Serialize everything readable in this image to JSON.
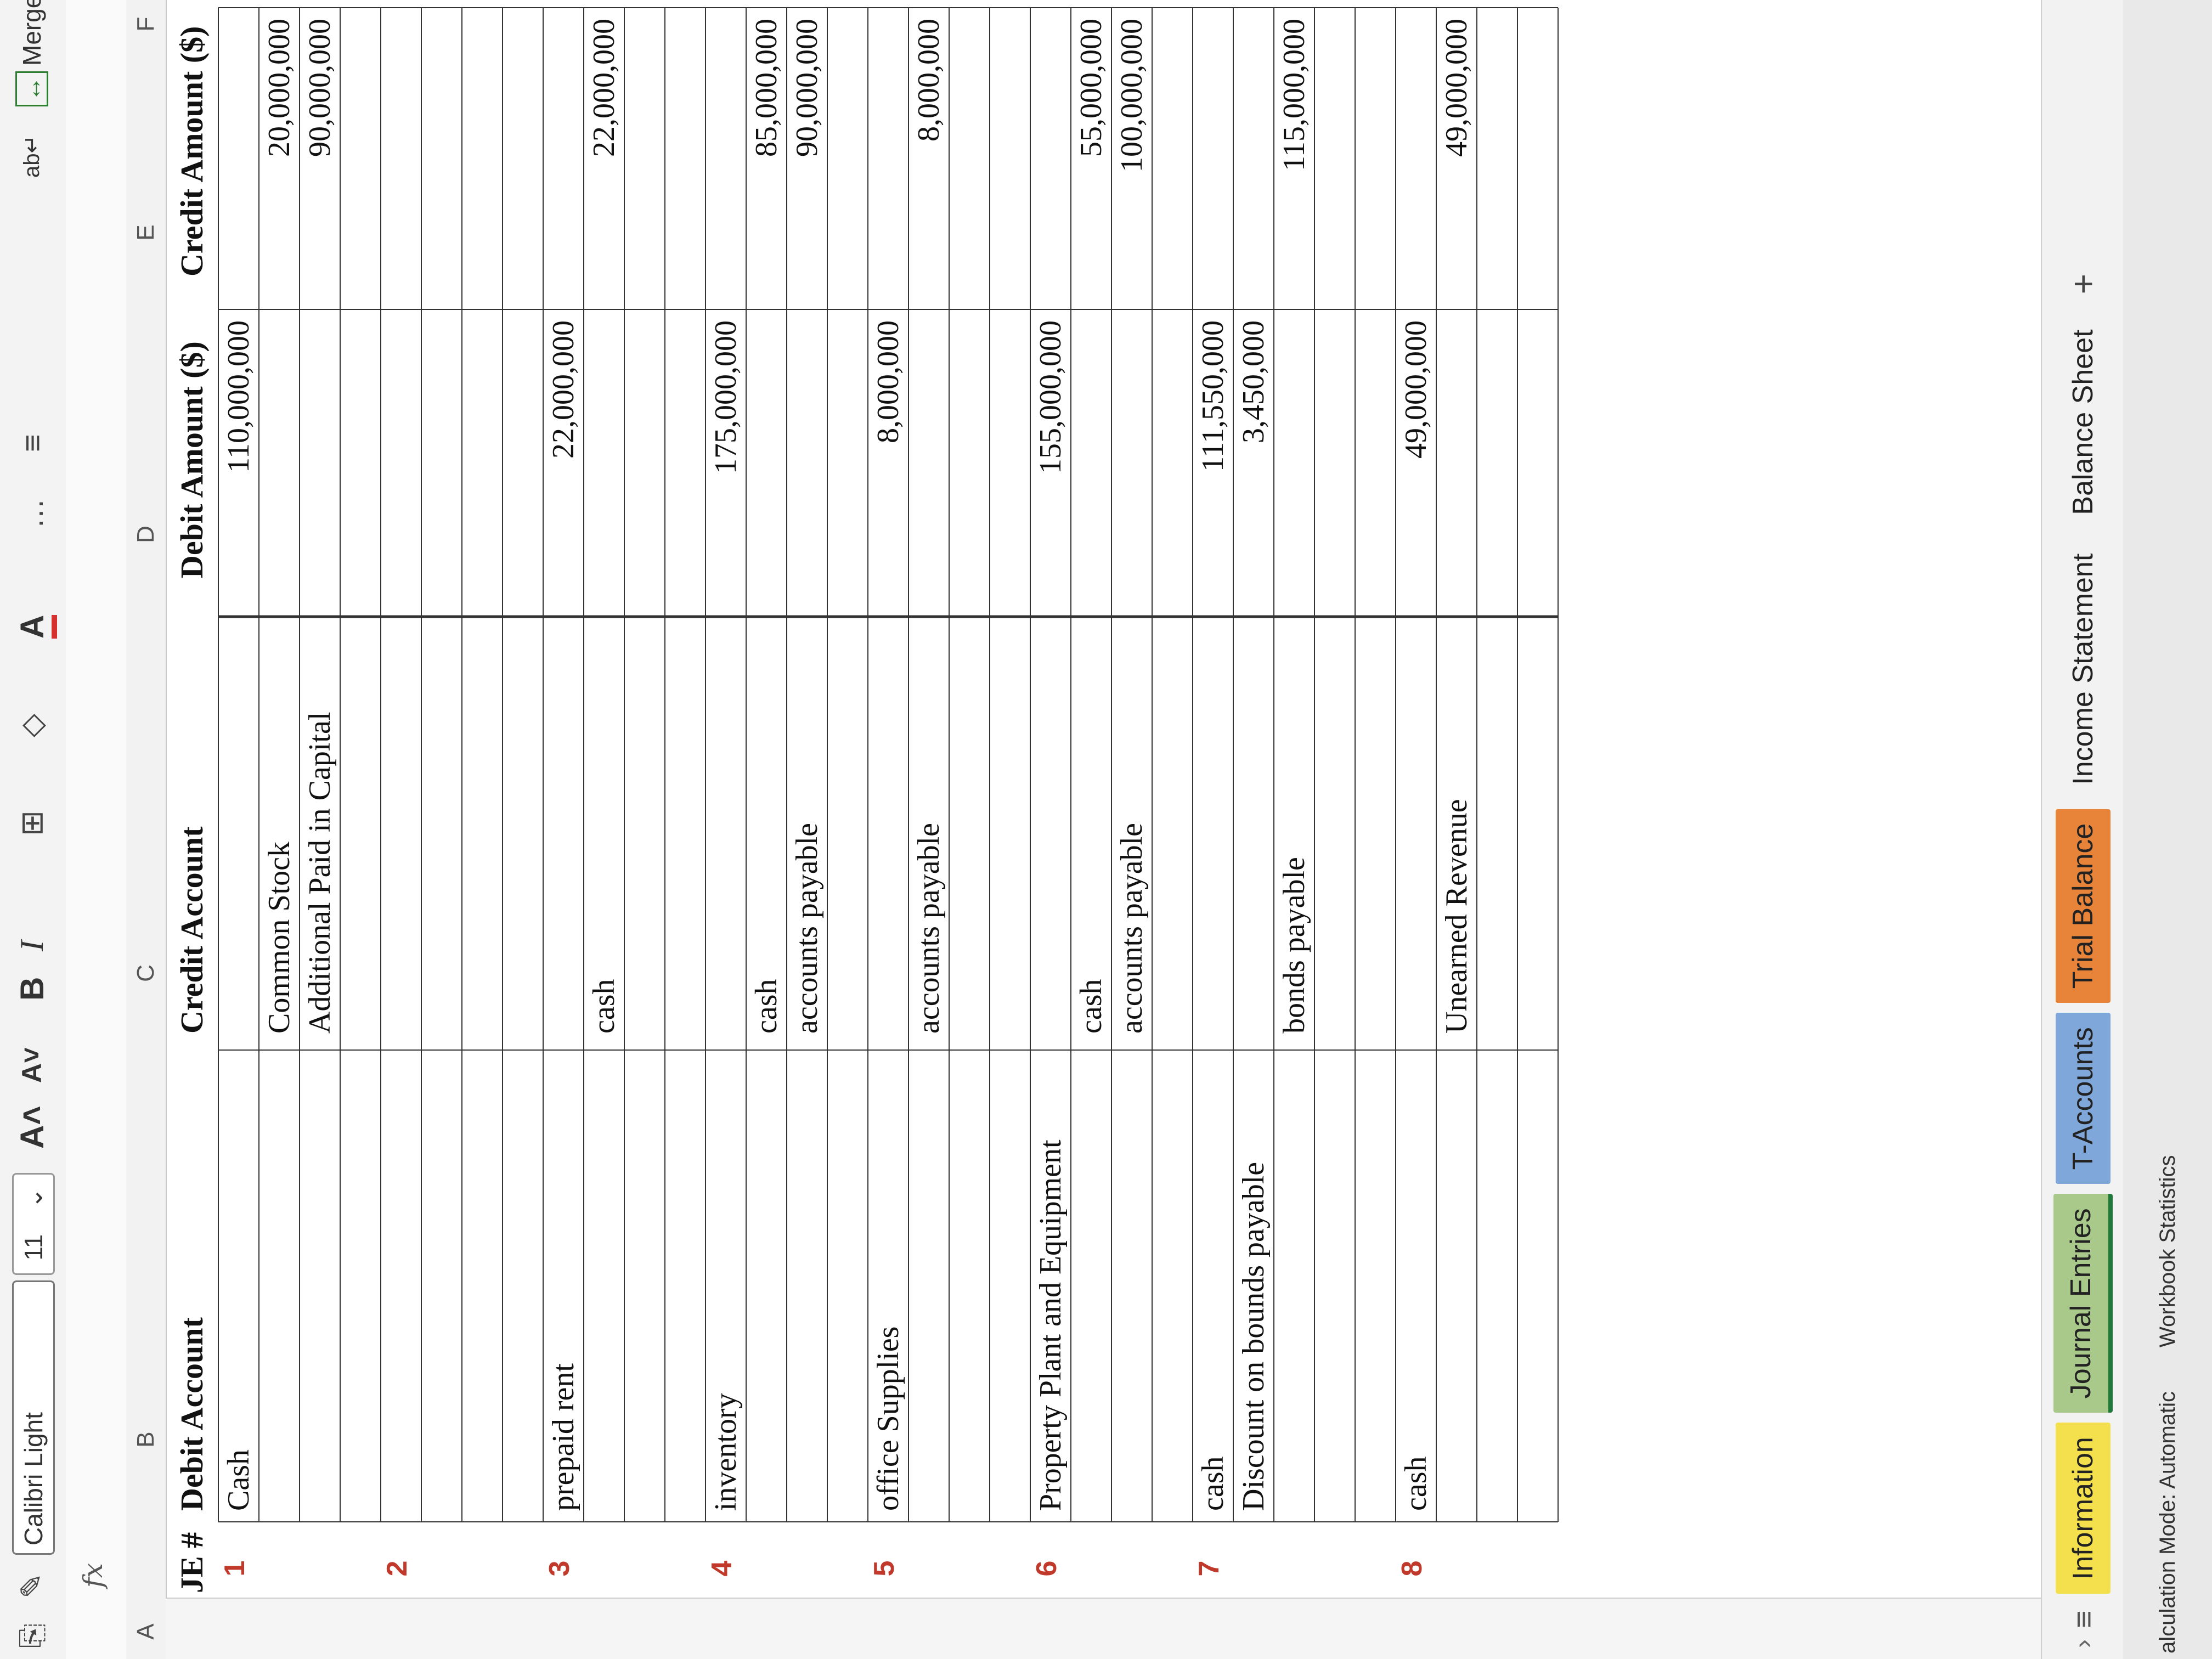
{
  "ribbon": {
    "font_name": "Calibri Light",
    "font_size": "11",
    "merge_label": "Merge"
  },
  "formula_bar": {
    "fx_label": "fx"
  },
  "columns": [
    "A",
    "B",
    "C",
    "D",
    "E",
    "F"
  ],
  "headers": {
    "je": "JE #",
    "debit_account": "Debit Account",
    "credit_account": "Credit Account",
    "debit_amount": "Debit Amount ($)",
    "credit_amount": "Credit Amount ($)"
  },
  "rows": [
    {
      "je": "1",
      "debit_account": "Cash",
      "credit_account": "",
      "debit": "110,000,000",
      "credit": ""
    },
    {
      "je": "",
      "debit_account": "",
      "credit_account": "Common Stock",
      "debit": "",
      "credit": "20,000,000"
    },
    {
      "je": "",
      "debit_account": "",
      "credit_account": "Additional Paid in Capital",
      "debit": "",
      "credit": "90,000,000"
    },
    {
      "je": "",
      "debit_account": "",
      "credit_account": "",
      "debit": "",
      "credit": ""
    },
    {
      "je": "2",
      "debit_account": "",
      "credit_account": "",
      "debit": "",
      "credit": ""
    },
    {
      "je": "",
      "debit_account": "",
      "credit_account": "",
      "debit": "",
      "credit": ""
    },
    {
      "je": "",
      "debit_account": "",
      "credit_account": "",
      "debit": "",
      "credit": ""
    },
    {
      "je": "",
      "debit_account": "",
      "credit_account": "",
      "debit": "",
      "credit": ""
    },
    {
      "je": "3",
      "debit_account": "prepaid rent",
      "credit_account": "",
      "debit": "22,000,000",
      "credit": ""
    },
    {
      "je": "",
      "debit_account": "",
      "credit_account": "cash",
      "debit": "",
      "credit": "22,000,000"
    },
    {
      "je": "",
      "debit_account": "",
      "credit_account": "",
      "debit": "",
      "credit": ""
    },
    {
      "je": "",
      "debit_account": "",
      "credit_account": "",
      "debit": "",
      "credit": ""
    },
    {
      "je": "4",
      "debit_account": "inventory",
      "credit_account": "",
      "debit": "175,000,000",
      "credit": ""
    },
    {
      "je": "",
      "debit_account": "",
      "credit_account": "cash",
      "debit": "",
      "credit": "85,000,000"
    },
    {
      "je": "",
      "debit_account": "",
      "credit_account": "accounts payable",
      "debit": "",
      "credit": "90,000,000"
    },
    {
      "je": "",
      "debit_account": "",
      "credit_account": "",
      "debit": "",
      "credit": ""
    },
    {
      "je": "5",
      "debit_account": "office Supplies",
      "credit_account": "",
      "debit": "8,000,000",
      "credit": ""
    },
    {
      "je": "",
      "debit_account": "",
      "credit_account": "accounts payable",
      "debit": "",
      "credit": "8,000,000"
    },
    {
      "je": "",
      "debit_account": "",
      "credit_account": "",
      "debit": "",
      "credit": ""
    },
    {
      "je": "",
      "debit_account": "",
      "credit_account": "",
      "debit": "",
      "credit": ""
    },
    {
      "je": "6",
      "debit_account": "Property Plant and Equipment",
      "credit_account": "",
      "debit": "155,000,000",
      "credit": ""
    },
    {
      "je": "",
      "debit_account": "",
      "credit_account": "cash",
      "debit": "",
      "credit": "55,000,000"
    },
    {
      "je": "",
      "debit_account": "",
      "credit_account": "accounts payable",
      "debit": "",
      "credit": "100,000,000"
    },
    {
      "je": "",
      "debit_account": "",
      "credit_account": "",
      "debit": "",
      "credit": ""
    },
    {
      "je": "7",
      "debit_account": "cash",
      "credit_account": "",
      "debit": "111,550,000",
      "credit": ""
    },
    {
      "je": "",
      "debit_account": "Discount on bounds payable",
      "credit_account": "",
      "debit": "3,450,000",
      "credit": ""
    },
    {
      "je": "",
      "debit_account": "",
      "credit_account": "bonds payable",
      "debit": "",
      "credit": "115,000,000"
    },
    {
      "je": "",
      "debit_account": "",
      "credit_account": "",
      "debit": "",
      "credit": ""
    },
    {
      "je": "",
      "debit_account": "",
      "credit_account": "",
      "debit": "",
      "credit": ""
    },
    {
      "je": "8",
      "debit_account": "cash",
      "credit_account": "",
      "debit": "49,000,000",
      "credit": ""
    },
    {
      "je": "",
      "debit_account": "",
      "credit_account": "Unearned Revenue",
      "debit": "",
      "credit": "49,000,000"
    },
    {
      "je": "",
      "debit_account": "",
      "credit_account": "",
      "debit": "",
      "credit": ""
    },
    {
      "je": "",
      "debit_account": "",
      "credit_account": "",
      "debit": "",
      "credit": ""
    }
  ],
  "sheet_tabs": [
    {
      "label": "Information",
      "color": "#f4e04d"
    },
    {
      "label": "Journal Entries",
      "color": "#a9c98b"
    },
    {
      "label": "T-Accounts",
      "color": "#7fa7d9"
    },
    {
      "label": "Trial Balance",
      "color": "#e8833a"
    },
    {
      "label": "Income Statement",
      "color": ""
    },
    {
      "label": "Balance Sheet",
      "color": ""
    }
  ],
  "add_sheet_label": "+",
  "status_bar": {
    "calc_mode": "alculation Mode: Automatic",
    "workbook_stats": "Workbook Statistics"
  }
}
